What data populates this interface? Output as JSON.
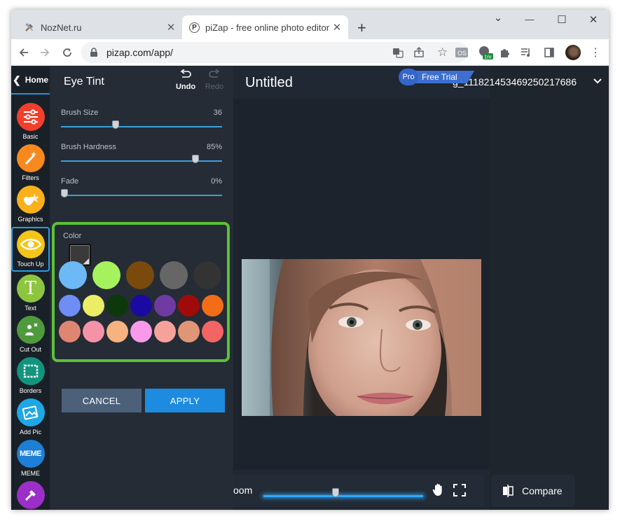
{
  "browser": {
    "tabs": [
      {
        "title": "NozNet.ru",
        "favicon": "tools-icon"
      },
      {
        "title": "piZap - free online photo editor -",
        "favicon": "pizap-p-icon",
        "favicon_letter": "P"
      }
    ],
    "new_tab": "+",
    "close_glyph": "✕",
    "url": "pizap.com/app/",
    "ext_badge": "1m",
    "controls": {
      "minimize": "—",
      "maximize": "☐",
      "close": "✕",
      "tab_search": "⌄"
    }
  },
  "toolbar": {
    "home_label": "Home",
    "tools": [
      {
        "label": "Basic",
        "color": "#f0402d",
        "icon": "sliders-icon"
      },
      {
        "label": "Filters",
        "color": "#f7891f",
        "icon": "magic-wand-icon"
      },
      {
        "label": "Graphics",
        "color": "#f9b11b",
        "icon": "graphics-icon"
      },
      {
        "label": "Touch Up",
        "color": "#f5c518",
        "icon": "eye-icon",
        "active": true
      },
      {
        "label": "Text",
        "color": "#8cc63f",
        "icon": "text-icon",
        "glyph": "T"
      },
      {
        "label": "Cut Out",
        "color": "#4f9a3c",
        "icon": "cutout-icon"
      },
      {
        "label": "Borders",
        "color": "#13947f",
        "icon": "border-icon"
      },
      {
        "label": "Add Pic",
        "color": "#1ea7e4",
        "icon": "add-pic-icon"
      },
      {
        "label": "MEME",
        "color": "#1d7fd6",
        "icon": "meme-icon",
        "glyph": "MEME"
      },
      {
        "label": "",
        "color": "#9b2fc7",
        "icon": "paint-icon"
      }
    ]
  },
  "panel": {
    "title": "Eye Tint",
    "undo": "Undo",
    "redo": "Redo",
    "sliders": [
      {
        "label": "Brush Size",
        "value": "36",
        "fraction": 0.33
      },
      {
        "label": "Brush Hardness",
        "value": "85%",
        "fraction": 0.85
      },
      {
        "label": "Fade",
        "value": "0%",
        "fraction": 0.0
      }
    ],
    "color_label": "Color",
    "current_color": "#3a3a3a",
    "swatch_rows": [
      [
        "#6cb9f5",
        "#a6f25e",
        "#7a4a0c",
        "#666666",
        "#333333"
      ],
      [
        "#6f8ef5",
        "#ebed64",
        "#0c380c",
        "#1a0aa1",
        "#6f3aa1",
        "#a10a0a",
        "#f36c18"
      ],
      [
        "#df8672",
        "#f493a8",
        "#f6b27f",
        "#f89ae9",
        "#f6a29a",
        "#e09577",
        "#f36464"
      ]
    ],
    "cancel": "CANCEL",
    "apply": "APPLY"
  },
  "stage": {
    "title": "Untitled",
    "zoom_label": "oom",
    "zoom_fraction": 0.45
  },
  "account": {
    "pro": "Pro",
    "trial": "Free Trial",
    "user_id": "g_111821453469250217686",
    "compare": "Compare"
  }
}
